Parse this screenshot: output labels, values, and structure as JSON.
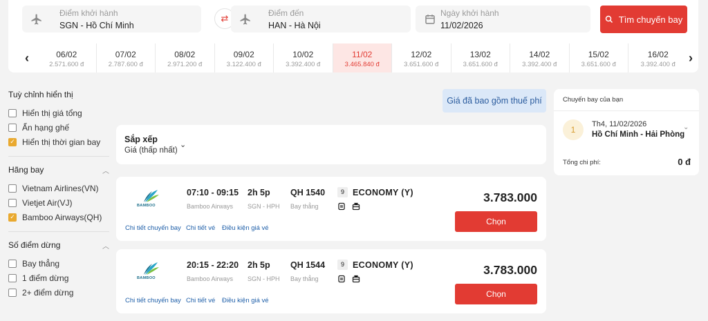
{
  "search": {
    "origin_label": "Điểm khởi hành",
    "origin_value": "SGN - Hồ Chí Minh",
    "destination_label": "Điểm đến",
    "destination_value": "HAN - Hà Nội",
    "date_label": "Ngày khởi hành",
    "date_value": "11/02/2026",
    "search_button": "Tìm chuyến bay"
  },
  "dates": [
    {
      "date": "06/02",
      "price": "2.571.600 đ"
    },
    {
      "date": "07/02",
      "price": "2.787.600 đ"
    },
    {
      "date": "08/02",
      "price": "2.971.200 đ"
    },
    {
      "date": "09/02",
      "price": "3.122.400 đ"
    },
    {
      "date": "10/02",
      "price": "3.392.400 đ"
    },
    {
      "date": "11/02",
      "price": "3.465.840 đ",
      "active": true
    },
    {
      "date": "12/02",
      "price": "3.651.600 đ"
    },
    {
      "date": "13/02",
      "price": "3.651.600 đ"
    },
    {
      "date": "14/02",
      "price": "3.392.400 đ"
    },
    {
      "date": "15/02",
      "price": "3.651.600 đ"
    },
    {
      "date": "16/02",
      "price": "3.392.400 đ"
    }
  ],
  "sidebar": {
    "display_heading": "Tuỳ chỉnh hiển thị",
    "display_options": [
      {
        "label": "Hiển thị giá tổng",
        "checked": false
      },
      {
        "label": "Ẩn hạng ghế",
        "checked": false
      },
      {
        "label": "Hiển thị thời gian bay",
        "checked": true
      }
    ],
    "airline_heading": "Hãng bay",
    "airline_options": [
      {
        "label": "Vietnam Airlines(VN)",
        "checked": false
      },
      {
        "label": "Vietjet Air(VJ)",
        "checked": false
      },
      {
        "label": "Bamboo Airways(QH)",
        "checked": true
      }
    ],
    "stops_heading": "Số điểm dừng",
    "stops_options": [
      {
        "label": "Bay thẳng",
        "checked": false
      },
      {
        "label": "1 điểm dừng",
        "checked": false
      },
      {
        "label": "2+ điểm dừng",
        "checked": false
      }
    ]
  },
  "tax_note": "Giá đã bao gồm thuế phí",
  "sort": {
    "title": "Sắp xếp",
    "value": "Giá (thấp nhất)"
  },
  "flights": [
    {
      "logo_text": "BAMBOO",
      "time": "07:10 - 09:15",
      "airline": "Bamboo Airways",
      "duration": "2h 5p",
      "route": "SGN - HPH",
      "code": "QH 1540",
      "type": "Bay thẳng",
      "seats": "9",
      "cabin": "ECONOMY (Y)",
      "price": "3.783.000",
      "choose": "Chọn",
      "link_detail": "Chi tiết chuyến bay",
      "link_ticket": "Chi tiết vé",
      "link_fare": "Điều kiện giá vé"
    },
    {
      "logo_text": "BAMBOO",
      "time": "20:15 - 22:20",
      "airline": "Bamboo Airways",
      "duration": "2h 5p",
      "route": "SGN - HPH",
      "code": "QH 1544",
      "type": "Bay thẳng",
      "seats": "9",
      "cabin": "ECONOMY (Y)",
      "price": "3.783.000",
      "choose": "Chọn",
      "link_detail": "Chi tiết chuyến bay",
      "link_ticket": "Chi tiết vé",
      "link_fare": "Điều kiện giá vé"
    }
  ],
  "trip": {
    "heading": "Chuyến bay của bạn",
    "step": "1",
    "date": "Th4, 11/02/2026",
    "route": "Hồ Chí Minh - Hải Phòng",
    "total_label": "Tổng chi phí:",
    "total_value": "0 đ"
  },
  "colors": {
    "accent": "#e23b33",
    "checkbox": "#e9a92f",
    "link": "#1d5ea8",
    "tax_bg": "#dbe8f8"
  }
}
